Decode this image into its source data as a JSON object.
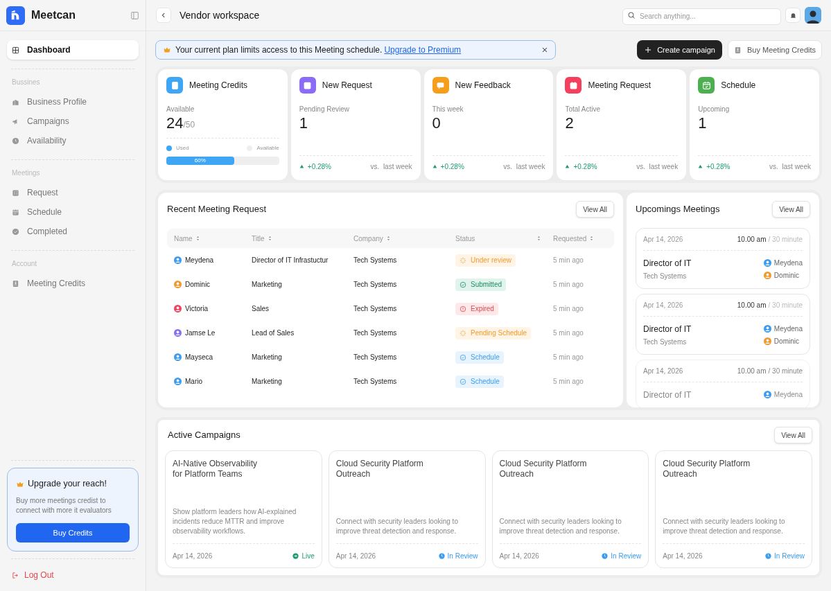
{
  "sidebar": {
    "brand": "Meetcan",
    "top_items": [
      {
        "label": "Dashboard",
        "selected": true
      }
    ],
    "sections": [
      {
        "title": "Bussines",
        "items": [
          {
            "label": "Business Profile",
            "selected": false
          },
          {
            "label": "Campaigns",
            "selected": false
          },
          {
            "label": "Availability",
            "selected": false
          }
        ]
      },
      {
        "title": "Meetings",
        "items": [
          {
            "label": "Request",
            "selected": false
          },
          {
            "label": "Schedule",
            "selected": false
          },
          {
            "label": "Completed",
            "selected": false
          }
        ]
      },
      {
        "title": "Account",
        "items": [
          {
            "label": "Meeting Credits",
            "selected": false
          }
        ]
      }
    ],
    "upgrade": {
      "title": "Upgrade your reach!",
      "text": "Buy more meetings credist to connect with more it evaluators",
      "button": "Buy Credits"
    },
    "logout": "Log Out"
  },
  "header": {
    "title": "Vendor workspace",
    "search": {
      "placeholder": "Search anything..."
    }
  },
  "banner": {
    "text": "Your current plan limits access to this Meeting schedule.",
    "link": "Upgrade to Premium"
  },
  "actions": [
    {
      "label": "Create campaign",
      "kind": "primary"
    },
    {
      "label": "Buy Meeting Credits",
      "kind": "secondary"
    }
  ],
  "stats": [
    {
      "kind": "credits",
      "title": "Meeting Credits",
      "color": "#3ea6f5",
      "label": "Available",
      "value": "24",
      "total": "/50",
      "legend": [
        "Used",
        "Available"
      ],
      "level": 0.6,
      "progress_label": "60%"
    },
    {
      "kind": "metric",
      "title": "New Request",
      "color": "#8b6cf6",
      "label": "Pending Review",
      "value": "1",
      "change": "+0.28%",
      "compare": "vs.  last week"
    },
    {
      "kind": "metric",
      "title": "New Feedback",
      "color": "#f59e1b",
      "label": "This week",
      "value": "0",
      "change": "+0.28%",
      "compare": "vs.  last week"
    },
    {
      "kind": "metric",
      "title": "Meeting Request",
      "color": "#f43f5e",
      "label": "Total Active",
      "value": "2",
      "change": "+0.28%",
      "compare": "vs.  last week"
    },
    {
      "kind": "metric",
      "title": "Schedule",
      "color": "#4caf50",
      "label": "Upcoming",
      "value": "1",
      "change": "+0.28%",
      "compare": "vs.  last week"
    }
  ],
  "requests": {
    "title": "Recent Meeting Request",
    "view_all": "View All",
    "columns": [
      "Name",
      "Title",
      "Company",
      "Status",
      "Requested"
    ],
    "rows": [
      {
        "name": "Meydena",
        "color": "#3b9cf0",
        "title": "Director of IT Infrastuctur",
        "company": "Tech Systems",
        "status": {
          "label": "Under review",
          "kind": "review"
        },
        "requested": "5 min ago"
      },
      {
        "name": "Dominic",
        "color": "#f2992e",
        "title": "Marketing",
        "company": "Tech Systems",
        "status": {
          "label": "Submitted",
          "kind": "submitted"
        },
        "requested": "5 min ago"
      },
      {
        "name": "Victoria",
        "color": "#ef4464",
        "title": "Sales",
        "company": "Tech Systems",
        "status": {
          "label": "Expired",
          "kind": "expired"
        },
        "requested": "5 min ago"
      },
      {
        "name": "Jamse Le",
        "color": "#8b6cf6",
        "title": "Lead of Sales",
        "company": "Tech Systems",
        "status": {
          "label": "Pending Schedule",
          "kind": "pending"
        },
        "requested": "5 min ago"
      },
      {
        "name": "Mayseca",
        "color": "#3b9cf0",
        "title": "Marketing",
        "company": "Tech Systems",
        "status": {
          "label": "Schedule",
          "kind": "schedule"
        },
        "requested": "5 min ago"
      },
      {
        "name": "Mario",
        "color": "#3b9cf0",
        "title": "Marketing",
        "company": "Tech Systems",
        "status": {
          "label": "Schedule",
          "kind": "schedule"
        },
        "requested": "5 min ago"
      }
    ]
  },
  "upcoming": {
    "title": "Upcomings Meetings",
    "view_all": "View All",
    "meetings": [
      {
        "date": "Apr 14, 2026",
        "time": "10.00 am",
        "duration": "/ 30 minute",
        "title": "Director of IT",
        "company": "Tech Systems",
        "faded": false,
        "attendees": [
          {
            "name": "Meydena",
            "color": "#3b9cf0"
          },
          {
            "name": "Dominic",
            "color": "#f2992e"
          }
        ]
      },
      {
        "date": "Apr 14, 2026",
        "time": "10.00 am",
        "duration": "/ 30 minute",
        "title": "Director of IT",
        "company": "Tech Systems",
        "faded": false,
        "attendees": [
          {
            "name": "Meydena",
            "color": "#3b9cf0"
          },
          {
            "name": "Dominic",
            "color": "#f2992e"
          }
        ]
      },
      {
        "date": "Apr 14, 2026",
        "time": "10.00 am",
        "duration": "/ 30 minute",
        "title": "Director of IT",
        "faded": true,
        "attendees": [
          {
            "name": "Meydena",
            "color": "#3b9cf0"
          }
        ]
      }
    ]
  },
  "campaigns": {
    "title": "Active Campaigns",
    "view_all": "View All",
    "items": [
      {
        "title": "AI-Native Observability\nfor Platform Teams",
        "description": "Show platform leaders how AI-explained incidents reduce MTTR and improve observability workflows.",
        "date": "Apr 14, 2026",
        "status": {
          "label": "Live",
          "kind": "live"
        }
      },
      {
        "title": "Cloud Security Platform\nOutreach",
        "description": "Connect with security leaders looking to improve threat detection and response.",
        "date": "Apr 14, 2026",
        "status": {
          "label": "In Review",
          "kind": "review"
        }
      },
      {
        "title": "Cloud Security Platform\nOutreach",
        "description": "Connect with security leaders looking to improve threat detection and response.",
        "date": "Apr 14, 2026",
        "status": {
          "label": "In Review",
          "kind": "review"
        }
      },
      {
        "title": "Cloud Security Platform\nOutreach",
        "description": "Connect with security leaders looking to improve threat detection and response.",
        "date": "Apr 14, 2026",
        "status": {
          "label": "In Review",
          "kind": "review"
        }
      }
    ]
  }
}
